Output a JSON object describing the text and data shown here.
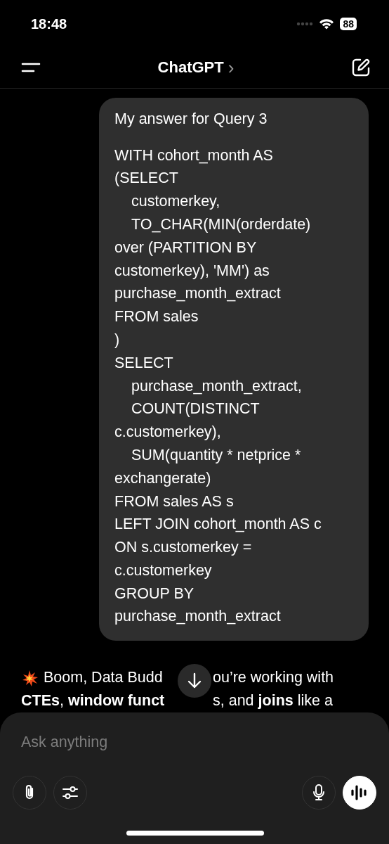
{
  "status_bar": {
    "time": "18:48",
    "battery": "88"
  },
  "header": {
    "title": "ChatGPT",
    "chevron": "›"
  },
  "user_message": {
    "title": "My answer for Query 3",
    "lines": [
      {
        "text": "WITH cohort_month AS",
        "indent": false
      },
      {
        "text": "(SELECT",
        "indent": false
      },
      {
        "text": "customerkey,",
        "indent": true
      },
      {
        "text": "TO_CHAR(MIN(orderdate)",
        "indent": true
      },
      {
        "text": "over (PARTITION BY",
        "indent": false
      },
      {
        "text": "customerkey), 'MM') as",
        "indent": false
      },
      {
        "text": "purchase_month_extract",
        "indent": false
      },
      {
        "text": "FROM sales",
        "indent": false
      },
      {
        "text": ")",
        "indent": false
      },
      {
        "text": "SELECT",
        "indent": false
      },
      {
        "text": "purchase_month_extract,",
        "indent": true
      },
      {
        "text": "COUNT(DISTINCT",
        "indent": true
      },
      {
        "text": "c.customerkey),",
        "indent": false
      },
      {
        "text": "SUM(quantity * netprice *",
        "indent": true
      },
      {
        "text": "exchangerate)",
        "indent": false
      },
      {
        "text": "FROM sales AS s",
        "indent": false
      },
      {
        "text": "LEFT JOIN cohort_month AS c",
        "indent": false
      },
      {
        "text": "ON s.customerkey =",
        "indent": false
      },
      {
        "text": "c.customerkey",
        "indent": false
      },
      {
        "text": "GROUP BY",
        "indent": false
      },
      {
        "text": "purchase_month_extract",
        "indent": false
      }
    ]
  },
  "assistant_message": {
    "lines": [
      {
        "before": "Boom, Data Budd",
        "after": "ou’re working with"
      },
      {
        "before": "**CTEs**, **window funct**",
        "after": "s, and **joins** like a"
      }
    ]
  },
  "composer": {
    "placeholder": "Ask anything"
  }
}
